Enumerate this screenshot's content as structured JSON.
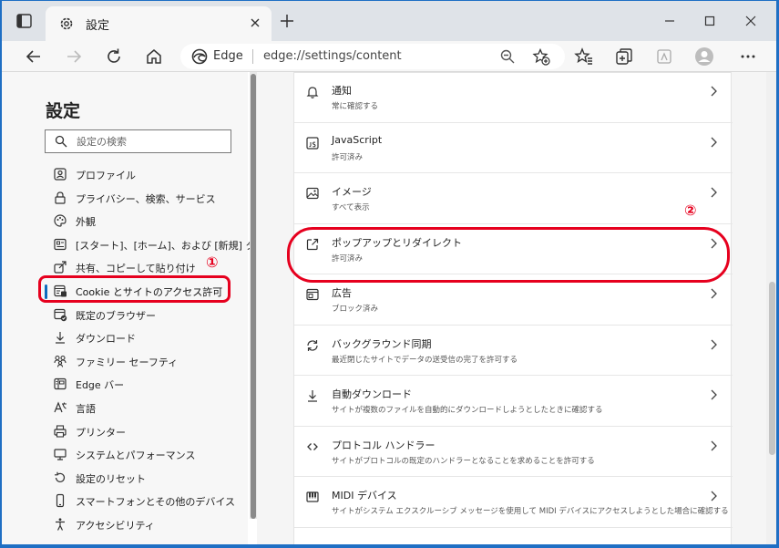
{
  "browser": {
    "tab_title": "設定",
    "address_label": "Edge",
    "url": "edge://settings/content"
  },
  "sidebar": {
    "title": "設定",
    "search_placeholder": "設定の検索",
    "items": [
      {
        "label": "プロファイル",
        "icon": "profile-icon"
      },
      {
        "label": "プライバシー、検索、サービス",
        "icon": "lock-icon"
      },
      {
        "label": "外観",
        "icon": "palette-icon"
      },
      {
        "label": "[スタート]、[ホーム]、および [新規] タブ",
        "icon": "newtab-page-icon"
      },
      {
        "label": "共有、コピーして貼り付け",
        "icon": "share-icon"
      },
      {
        "label": "Cookie とサイトのアクセス許可",
        "icon": "site-permissions-icon",
        "active": true
      },
      {
        "label": "既定のブラウザー",
        "icon": "default-browser-icon"
      },
      {
        "label": "ダウンロード",
        "icon": "download-icon"
      },
      {
        "label": "ファミリー セーフティ",
        "icon": "family-icon"
      },
      {
        "label": "Edge バー",
        "icon": "edge-bar-icon"
      },
      {
        "label": "言語",
        "icon": "language-icon"
      },
      {
        "label": "プリンター",
        "icon": "printer-icon"
      },
      {
        "label": "システムとパフォーマンス",
        "icon": "system-icon"
      },
      {
        "label": "設定のリセット",
        "icon": "reset-icon"
      },
      {
        "label": "スマートフォンとその他のデバイス",
        "icon": "phone-icon"
      },
      {
        "label": "アクセシビリティ",
        "icon": "accessibility-icon"
      }
    ]
  },
  "main": {
    "rows": [
      {
        "title": "通知",
        "subtitle": "常に確認する",
        "icon": "bell-icon"
      },
      {
        "title": "JavaScript",
        "subtitle": "許可済み",
        "icon": "javascript-icon"
      },
      {
        "title": "イメージ",
        "subtitle": "すべて表示",
        "icon": "image-icon"
      },
      {
        "title": "ポップアップとリダイレクト",
        "subtitle": "許可済み",
        "icon": "popup-icon"
      },
      {
        "title": "広告",
        "subtitle": "ブロック済み",
        "icon": "ads-icon"
      },
      {
        "title": "バックグラウンド同期",
        "subtitle": "最近閉じたサイトでデータの送受信の完了を許可する",
        "icon": "sync-icon"
      },
      {
        "title": "自動ダウンロード",
        "subtitle": "サイトが複数のファイルを自動的にダウンロードしようとしたときに確認する",
        "icon": "auto-download-icon"
      },
      {
        "title": "プロトコル ハンドラー",
        "subtitle": "サイトがプロトコルの既定のハンドラーとなることを求めることを許可する",
        "icon": "protocol-icon"
      },
      {
        "title": "MIDI デバイス",
        "subtitle": "サイトがシステム エクスクルーシブ メッセージを使用して MIDI デバイスにアクセスしようとした場合に確認する",
        "icon": "midi-icon"
      }
    ]
  },
  "annotations": {
    "marker1": "①",
    "marker2": "②"
  },
  "colors": {
    "accent": "#0f6cbd",
    "highlight": "#e6001e",
    "frame": "#1f6fc4"
  }
}
